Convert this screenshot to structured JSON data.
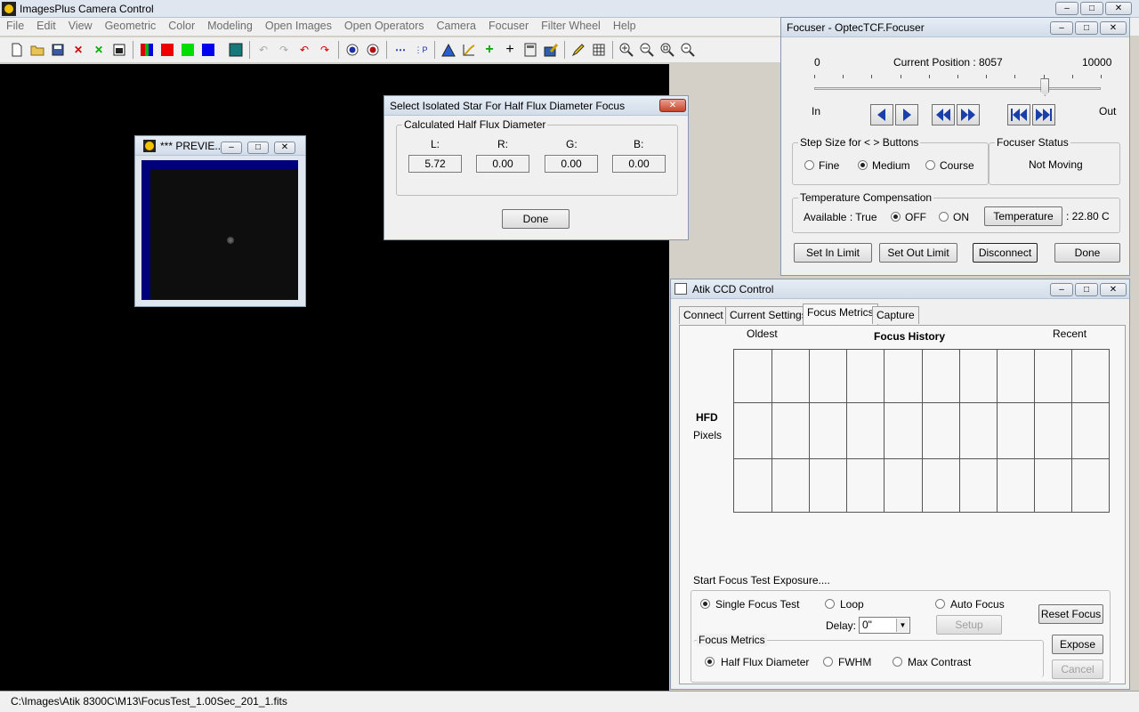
{
  "app": {
    "title": "ImagesPlus Camera Control",
    "menu": [
      "File",
      "Edit",
      "View",
      "Geometric",
      "Color",
      "Modeling",
      "Open Images",
      "Open Operators",
      "Camera",
      "Focuser",
      "Filter Wheel",
      "Help"
    ],
    "status_path": "C:\\Images\\Atik 8300C\\M13\\FocusTest_1.00Sec_201_1.fits"
  },
  "preview": {
    "title": "*** PREVIE..."
  },
  "hfd_dialog": {
    "title": "Select Isolated Star For Half Flux Diameter Focus",
    "group_label": "Calculated Half Flux Diameter",
    "channels": [
      {
        "label": "L:",
        "value": "5.72"
      },
      {
        "label": "R:",
        "value": "0.00"
      },
      {
        "label": "G:",
        "value": "0.00"
      },
      {
        "label": "B:",
        "value": "0.00"
      }
    ],
    "done_label": "Done"
  },
  "focuser": {
    "title": "Focuser - OptecTCF.Focuser",
    "min_label": "0",
    "max_label": "10000",
    "position_label": "Current Position :",
    "position_value": "8057",
    "position_fraction": 0.8057,
    "in_label": "In",
    "out_label": "Out",
    "step_group": "Step Size for < > Buttons",
    "step_options": [
      "Fine",
      "Medium",
      "Course"
    ],
    "step_selected": "Medium",
    "status_group": "Focuser Status",
    "status_value": "Not Moving",
    "temp_group": "Temperature Compensation",
    "available_label": "Available : True",
    "temp_off": "OFF",
    "temp_on": "ON",
    "temp_button": "Temperature",
    "temp_value": ": 22.80 C",
    "buttons": {
      "set_in": "Set In Limit",
      "set_out": "Set Out Limit",
      "disconnect": "Disconnect",
      "done": "Done"
    }
  },
  "atik": {
    "title": "Atik CCD Control",
    "tabs": [
      "Connect",
      "Current Settings",
      "Focus Metrics",
      "Capture"
    ],
    "oldest": "Oldest",
    "recent": "Recent",
    "chart_title": "Focus History",
    "axis_label": "HFD",
    "axis_unit": "Pixels",
    "start_label": "Start Focus Test Exposure....",
    "test_options": [
      "Single Focus Test",
      "Loop",
      "Auto Focus"
    ],
    "delay_label": "Delay:",
    "delay_value": "0\"",
    "setup_label": "Setup",
    "reset_focus": "Reset Focus",
    "expose": "Expose",
    "cancel": "Cancel",
    "metrics_group": "Focus Metrics",
    "metrics_options": [
      "Half Flux Diameter",
      "FWHM",
      "Max Contrast"
    ]
  }
}
